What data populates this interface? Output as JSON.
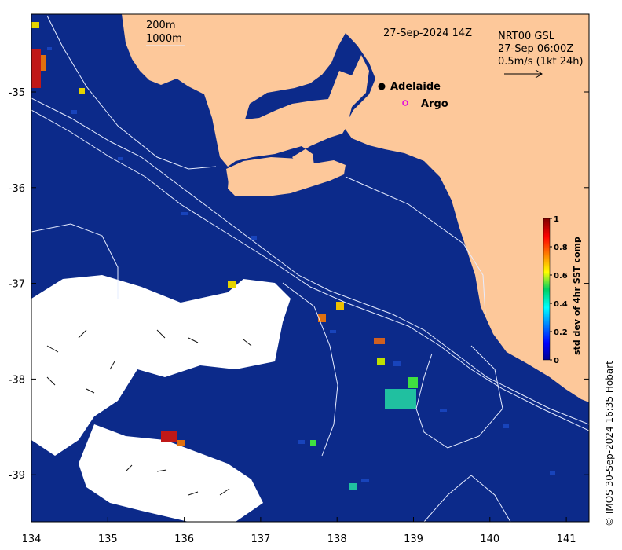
{
  "header": {
    "date_label": "27-Sep-2024 14Z",
    "product_label": "NRT00 GSL",
    "current_time_label": "27-Sep 06:00Z",
    "scale_label": "0.5m/s (1kt 24h)"
  },
  "legend": {
    "contour_200m": "200m",
    "contour_1000m": "1000m"
  },
  "places": {
    "adelaide": "Adelaide",
    "argo": "Argo"
  },
  "axes": {
    "x_ticks": [
      "134",
      "135",
      "136",
      "137",
      "138",
      "139",
      "140",
      "141"
    ],
    "y_ticks": [
      "-35",
      "-36",
      "-37",
      "-38",
      "-39"
    ]
  },
  "colorbar": {
    "label": "std dev of 4hr SST comp",
    "ticks": [
      "0",
      "0.2",
      "0.4",
      "0.6",
      "0.8",
      "1"
    ]
  },
  "credit": "© IMOS 30-Sep-2024 16:35 Hobart",
  "colors": {
    "ocean": "#0c2a8a",
    "land": "#fdc89a",
    "no_data": "#ffffff",
    "contour": "#e6ecff"
  }
}
